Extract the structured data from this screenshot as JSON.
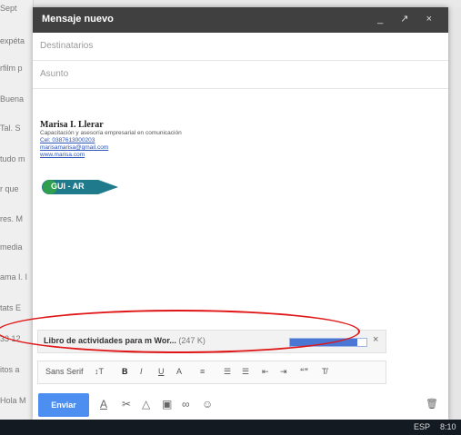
{
  "background": {
    "left_snippets": [
      "Sept",
      "expéta",
      "rfilm p",
      "Buena",
      "Tal. S",
      "tudo m",
      "r que",
      "res. M",
      "media",
      "ama I. I",
      "tats E",
      "33 12",
      "itos a",
      "Hola M"
    ]
  },
  "compose": {
    "title": "Mensaje nuevo",
    "to_placeholder": "Destinatarios",
    "subject_placeholder": "Asunto",
    "window_controls": "_ ↗ ×"
  },
  "signature": {
    "name": "Marisa I. Llerar",
    "line1": "Capacitación y asesoría empresarial en comunicación",
    "phone": "Cel: 0387613000203",
    "email": "marisamarisa@gmail.com",
    "website": "www.marisa.com",
    "logo_text": "GUI - AR"
  },
  "attachment": {
    "name": "Libro de actividades para m Wor...",
    "size": "(247 K)",
    "progress": 0.88,
    "close": "×"
  },
  "format_toolbar": {
    "font": "Sans Serif",
    "size": "↕T",
    "bold": "B",
    "italic": "I",
    "underline": "U",
    "text_color": "A",
    "align": "≡",
    "numbered": "☰",
    "bulleted": "☰",
    "indent_less": "⇤",
    "indent_more": "⇥",
    "quote": "“”",
    "clear": "T̸"
  },
  "send_bar": {
    "send_label": "Enviar",
    "format_icon": "A",
    "attach_icon": "✂",
    "drive_icon": "△",
    "photo_icon": "▣",
    "link_icon": "∞",
    "emoji_icon": "☺",
    "trash_icon": "🗑"
  },
  "taskbar": {
    "lang": "ESP",
    "time": "8:10"
  }
}
